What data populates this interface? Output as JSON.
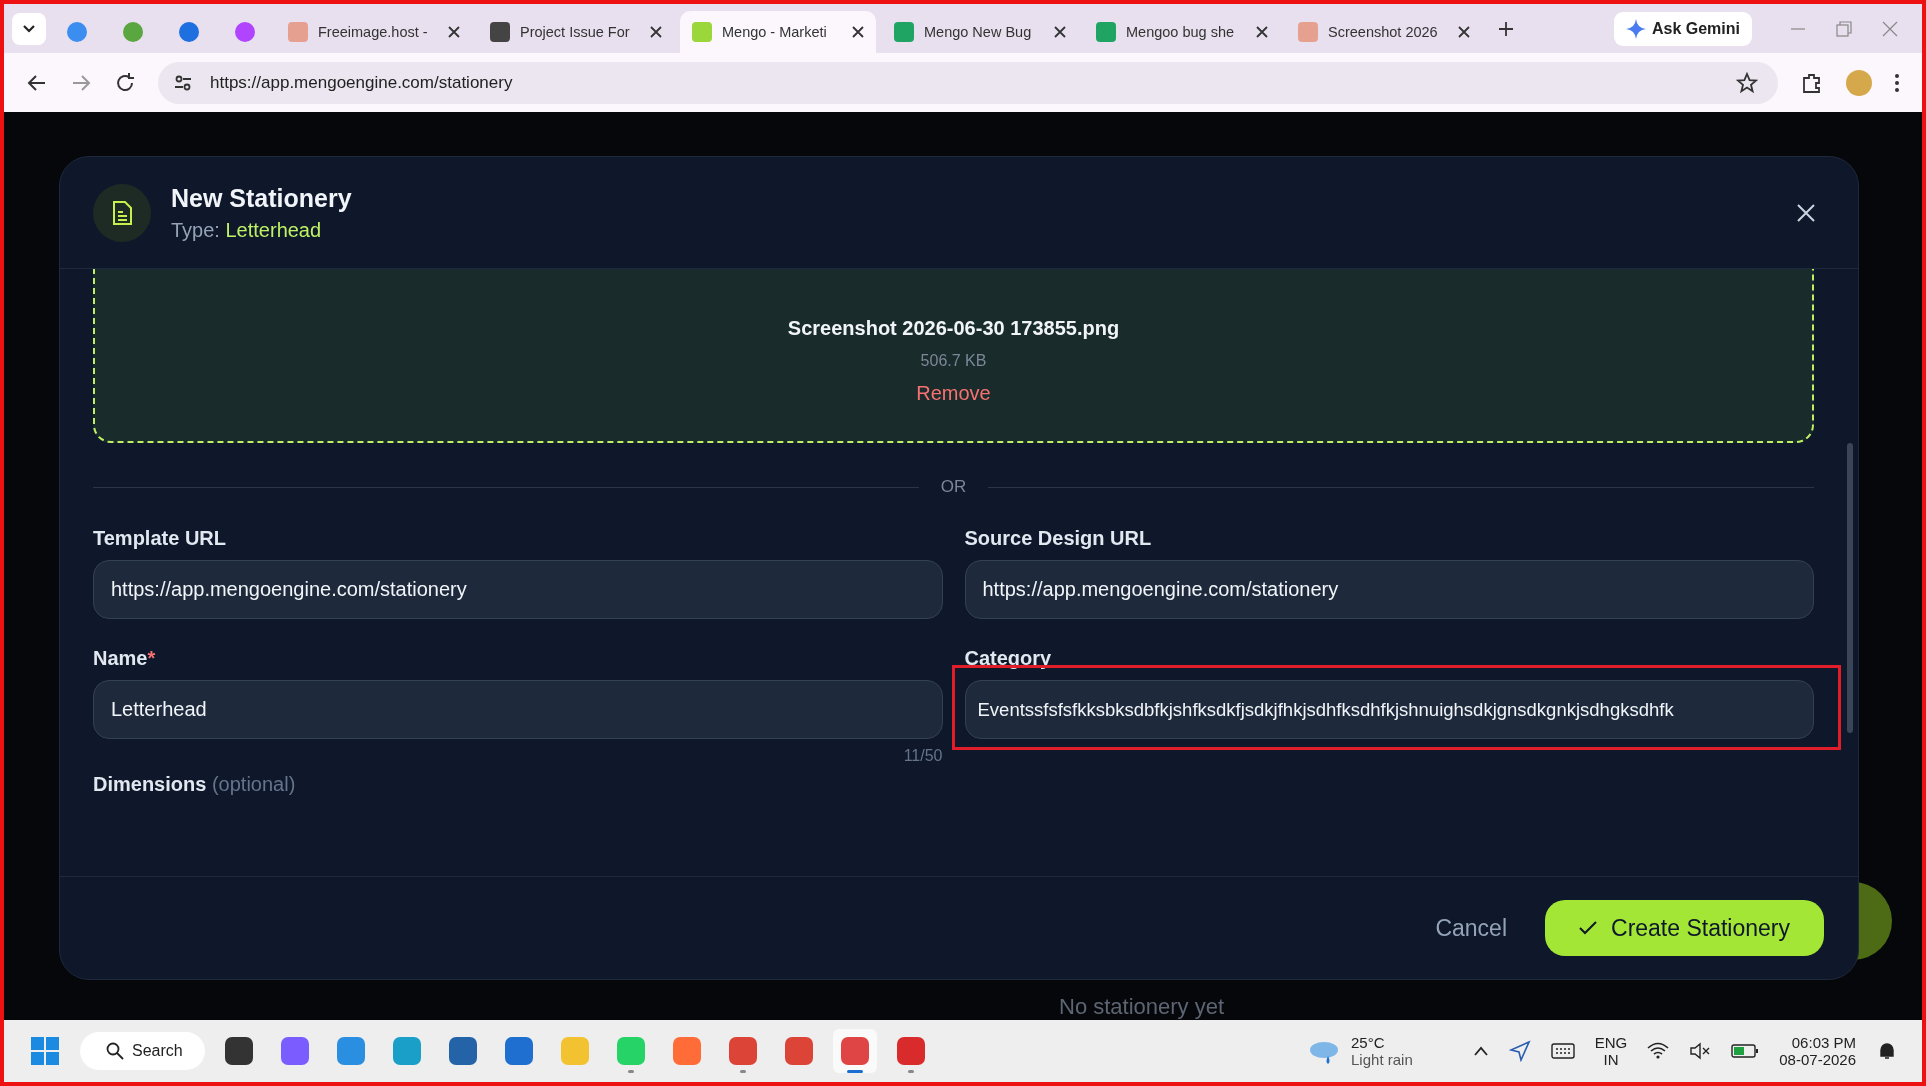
{
  "browser": {
    "tabs": [
      {
        "kind": "pinned",
        "selected": false
      },
      {
        "kind": "pinned",
        "selected": false
      },
      {
        "kind": "pinned",
        "selected": false
      },
      {
        "kind": "pinned",
        "selected": false
      },
      {
        "kind": "titled",
        "title": "Freeimage.host -",
        "selected": false
      },
      {
        "kind": "titled",
        "title": "Project Issue For",
        "selected": false
      },
      {
        "kind": "titled",
        "title": "Mengo - Marketi",
        "selected": true
      },
      {
        "kind": "titled",
        "title": "Mengo New Bug",
        "selected": false
      },
      {
        "kind": "titled",
        "title": "Mengoo bug she",
        "selected": false
      },
      {
        "kind": "titled",
        "title": "Screenshot 2026",
        "selected": false
      }
    ],
    "gemini": "Ask Gemini",
    "url": "https://app.mengoengine.com/stationery"
  },
  "page": {
    "empty_text": "No stationery yet"
  },
  "modal": {
    "title": "New Stationery",
    "type_label": "Type:",
    "type_value": "Letterhead",
    "upload": {
      "file_name": "Screenshot 2026-06-30 173855.png",
      "file_size": "506.7 KB",
      "remove": "Remove"
    },
    "divider": "OR",
    "fields": [
      {
        "label": "Template URL",
        "value": "https://app.mengoengine.com/stationery"
      },
      {
        "label": "Source Design URL",
        "value": "https://app.mengoengine.com/stationery"
      },
      {
        "label": "Name",
        "required_mark": "*",
        "value": "Letterhead",
        "counter": "11/50"
      },
      {
        "label": "Category",
        "value": "Eventssfsfsfkksbksdbfkjshfksdkfjsdkjfhkjsdhfksdhfkjshnuighsdkjgnsdkgnkjsdhgksdhfk",
        "highlighted": true
      }
    ],
    "dimensions_label": "Dimensions",
    "dimensions_hint": "(optional)",
    "cancel": "Cancel",
    "create": "Create Stationery"
  },
  "taskbar": {
    "search": "Search",
    "temperature": "25°C",
    "weather": "Light rain",
    "language": "ENG",
    "region": "IN",
    "time": "06:03 PM",
    "date": "08-07-2026",
    "apps": [
      {
        "running": false,
        "active": false
      },
      {
        "running": false,
        "active": false
      },
      {
        "running": false,
        "active": false
      },
      {
        "running": false,
        "active": false
      },
      {
        "running": false,
        "active": false
      },
      {
        "running": false,
        "active": false
      },
      {
        "running": false,
        "active": false
      },
      {
        "running": true,
        "active": false
      },
      {
        "running": false,
        "active": false
      },
      {
        "running": true,
        "active": false
      },
      {
        "running": false,
        "active": false
      },
      {
        "running": true,
        "active": true
      },
      {
        "running": true,
        "active": false
      }
    ]
  }
}
